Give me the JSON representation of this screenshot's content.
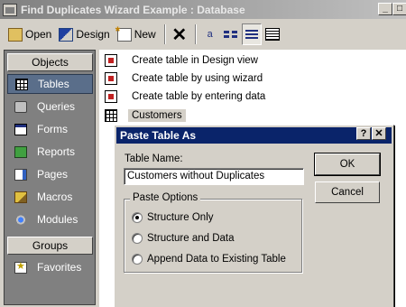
{
  "window": {
    "title": "Find Duplicates Wizard Example : Database",
    "minimize_glyph": "_",
    "maximize_glyph": "□"
  },
  "toolbar": {
    "open_label": "Open",
    "design_label": "Design",
    "new_label": "New",
    "delete_glyph": "✕",
    "large_icons_glyph": "a"
  },
  "sidebar": {
    "objects_header": "Objects",
    "groups_header": "Groups",
    "items": [
      {
        "label": "Tables",
        "icon": "tables-icon",
        "selected": true
      },
      {
        "label": "Queries",
        "icon": "queries-icon"
      },
      {
        "label": "Forms",
        "icon": "forms-icon"
      },
      {
        "label": "Reports",
        "icon": "reports-icon"
      },
      {
        "label": "Pages",
        "icon": "pages-icon"
      },
      {
        "label": "Macros",
        "icon": "macros-icon"
      },
      {
        "label": "Modules",
        "icon": "modules-icon"
      }
    ],
    "group_items": [
      {
        "label": "Favorites",
        "icon": "favorites-icon"
      }
    ]
  },
  "list": {
    "items": [
      {
        "label": "Create table in Design view",
        "icon": "wizard-icon"
      },
      {
        "label": "Create table by using wizard",
        "icon": "wizard-icon"
      },
      {
        "label": "Create table by entering data",
        "icon": "wizard-icon"
      },
      {
        "label": "Customers",
        "icon": "table-icon",
        "selected": true
      }
    ]
  },
  "dialog": {
    "title": "Paste Table As",
    "help_glyph": "?",
    "close_glyph": "✕",
    "table_name_label": "Table Name:",
    "table_name_value": "Customers without Duplicates",
    "ok_label": "OK",
    "cancel_label": "Cancel",
    "paste_options_label": "Paste Options",
    "options": [
      {
        "label": "Structure Only",
        "checked": true
      },
      {
        "label": "Structure and Data",
        "checked": false
      },
      {
        "label": "Append Data to Existing Table",
        "checked": false
      }
    ]
  }
}
